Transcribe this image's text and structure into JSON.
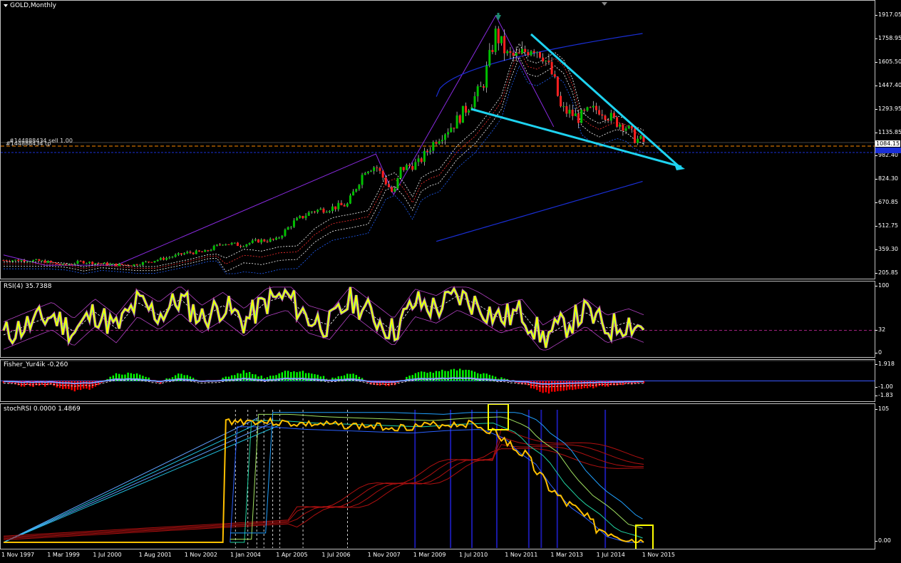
{
  "chart_title": "GOLD,Monthly",
  "colors": {
    "background": "#000000",
    "grid": "#c0c0c0",
    "bull": "#00c000",
    "bear": "#ff2020",
    "trendline": "#1ed3f0",
    "envelope": "#1a2fd6",
    "rsi": "#ffff00",
    "stoch": "#ffc000",
    "highlight": "#ffff00",
    "hist_pos": "#00ff00",
    "hist_neg": "#ff0000"
  },
  "order": {
    "label_a": "#144888434 sell 1.00",
    "label_b": "#144888434 tp"
  },
  "chart_data": [
    {
      "type": "line",
      "title": "GOLD,Monthly",
      "x_ticks": [
        "1 Nov 1997",
        "1 Mar 1999",
        "1 Jul 2000",
        "1 Aug 2001",
        "1 Nov 2002",
        "1 Jan 2004",
        "1 Apr 2005",
        "1 Jul 2006",
        "1 Nov 2007",
        "1 Mar 2009",
        "1 Jul 2010",
        "1 Nov 2011",
        "1 Mar 2013",
        "1 Jul 2014",
        "1 Nov 2015"
      ],
      "y_ticks": [
        "1917.05",
        "1758.95",
        "1605.50",
        "1447.40",
        "1293.95",
        "1135.85",
        "982.40",
        "824.30",
        "670.85",
        "512.75",
        "359.30",
        "205.85"
      ],
      "ylim": [
        205.85,
        1917.05
      ],
      "current_price": "1084.15",
      "x": [
        1997.83,
        1998.5,
        1999.0,
        1999.5,
        2000.0,
        2000.5,
        2001.0,
        2001.5,
        2002.0,
        2002.5,
        2003.0,
        2003.5,
        2004.0,
        2004.5,
        2005.0,
        2005.5,
        2006.0,
        2006.5,
        2007.0,
        2007.5,
        2008.0,
        2008.3,
        2008.8,
        2009.0,
        2009.5,
        2010.0,
        2010.5,
        2011.0,
        2011.3,
        2011.67,
        2012.0,
        2012.3,
        2012.7,
        2013.0,
        2013.3,
        2013.5,
        2014.0,
        2014.3,
        2014.6,
        2015.0,
        2015.3,
        2015.6,
        2015.83
      ],
      "series": [
        {
          "values": [
            295,
            295,
            287,
            262,
            285,
            275,
            265,
            265,
            290,
            315,
            345,
            350,
            410,
            395,
            425,
            430,
            550,
            620,
            640,
            665,
            900,
            920,
            730,
            900,
            940,
            1100,
            1200,
            1350,
            1450,
            1800,
            1650,
            1640,
            1720,
            1660,
            1500,
            1300,
            1240,
            1280,
            1300,
            1220,
            1190,
            1100,
            1080
          ]
        }
      ]
    },
    {
      "type": "line",
      "title": "RSI(4) 35.7388",
      "y_ticks": [
        "100",
        "32",
        "0"
      ],
      "ylim": [
        0,
        100
      ],
      "x": [
        1997.83,
        1998.5,
        1999.2,
        1999.8,
        2000.4,
        2001.0,
        2001.6,
        2002.2,
        2002.8,
        2003.4,
        2004.0,
        2004.6,
        2005.2,
        2005.8,
        2006.4,
        2007.0,
        2007.6,
        2008.2,
        2008.8,
        2009.4,
        2010.0,
        2010.6,
        2011.2,
        2011.8,
        2012.4,
        2013.0,
        2013.6,
        2014.2,
        2014.8,
        2015.4,
        2015.83
      ],
      "series": [
        {
          "values": [
            25,
            40,
            55,
            30,
            60,
            35,
            75,
            55,
            80,
            50,
            70,
            45,
            75,
            85,
            50,
            40,
            80,
            55,
            30,
            75,
            65,
            85,
            70,
            50,
            60,
            20,
            40,
            60,
            35,
            45,
            35.74
          ]
        }
      ]
    },
    {
      "type": "bar",
      "title": "Fisher_Yur4ik -0.260",
      "y_ticks": [
        "1.918",
        "-1.00",
        "-1.83"
      ],
      "ylim": [
        -1.83,
        1.918
      ],
      "x": [
        1997.83,
        1998.5,
        1999.2,
        1999.8,
        2000.4,
        2001.0,
        2001.6,
        2002.2,
        2002.8,
        2003.4,
        2004.0,
        2004.6,
        2005.2,
        2005.8,
        2006.4,
        2007.0,
        2007.6,
        2008.2,
        2008.8,
        2009.4,
        2010.0,
        2010.6,
        2011.2,
        2011.8,
        2012.4,
        2013.0,
        2013.6,
        2014.2,
        2014.8,
        2015.4,
        2015.83
      ],
      "series": [
        {
          "values": [
            -0.2,
            -0.6,
            -0.5,
            -1.2,
            -0.8,
            0.8,
            0.9,
            -0.3,
            1.0,
            -0.2,
            0.3,
            1.1,
            0.4,
            1.2,
            1.0,
            0.2,
            0.9,
            -0.4,
            -0.5,
            0.9,
            1.1,
            1.3,
            1.0,
            0.3,
            -0.3,
            -1.4,
            -1.2,
            -0.8,
            -0.6,
            -0.4,
            -0.26
          ]
        }
      ]
    },
    {
      "type": "line",
      "title": "stochRSI 0.0000 1.4869",
      "y_ticks": [
        "105",
        "0.00"
      ],
      "ylim": [
        0,
        105
      ],
      "x": [
        1997.83,
        2004.0,
        2004.05,
        2005.0,
        2006.0,
        2007.0,
        2008.0,
        2009.0,
        2010.0,
        2011.0,
        2011.67,
        2012.0,
        2012.5,
        2013.0,
        2013.5,
        2014.0,
        2014.5,
        2015.0,
        2015.5,
        2015.83
      ],
      "series": [
        {
          "values": [
            0,
            0,
            100,
            100,
            98,
            97,
            96,
            95,
            97,
            98,
            90,
            80,
            70,
            50,
            35,
            25,
            12,
            8,
            3,
            0
          ]
        }
      ]
    }
  ]
}
